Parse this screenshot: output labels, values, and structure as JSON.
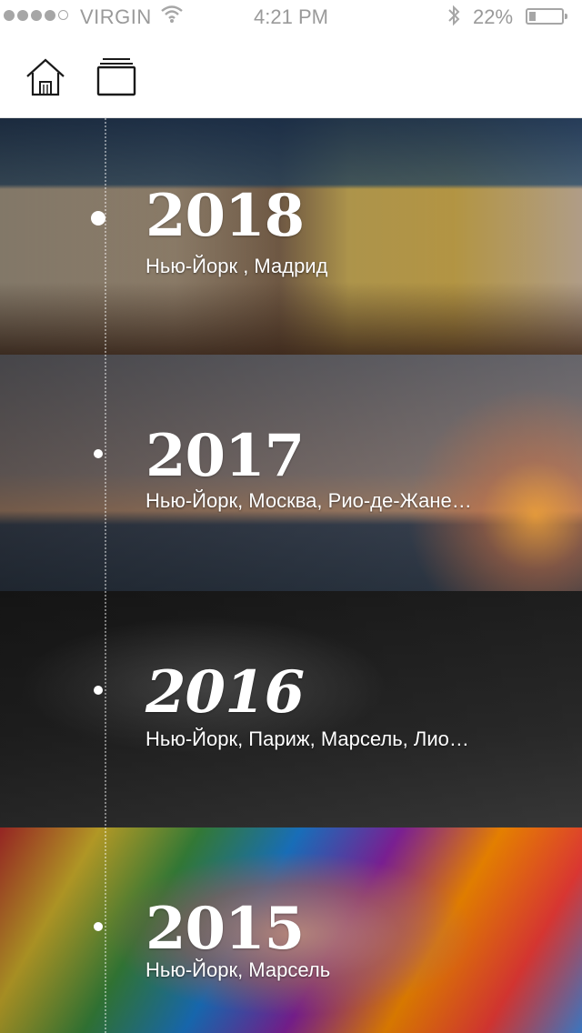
{
  "status_bar": {
    "carrier": "VIRGIN",
    "time": "4:21 PM",
    "battery_percent_label": "22%",
    "battery_level": 0.22,
    "signal_bars_filled": 4,
    "signal_bars_total": 5
  },
  "nav": {
    "home_icon": "home-icon",
    "stack_icon": "card-stack-icon"
  },
  "timeline": [
    {
      "year": "2018",
      "cities": "Нью-Йорк , Мадрид"
    },
    {
      "year": "2017",
      "cities": "Нью-Йорк, Москва, Рио-де-Жане…"
    },
    {
      "year": "2016",
      "cities": "Нью-Йорк, Париж, Марсель, Лио…"
    },
    {
      "year": "2015",
      "cities": "Нью-Йорк, Марсель"
    }
  ],
  "colors": {
    "status_text": "#9a9a9a",
    "nav_icon": "#1a1a1a",
    "year_text": "#ffffff"
  }
}
